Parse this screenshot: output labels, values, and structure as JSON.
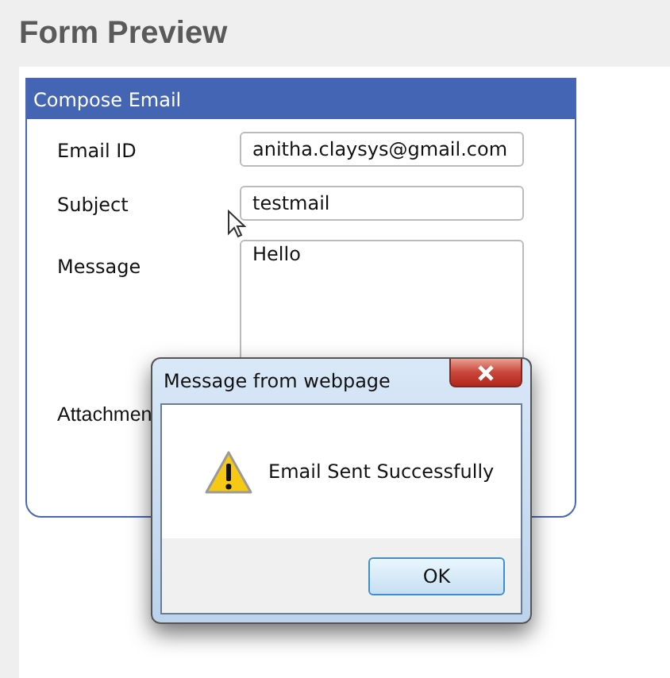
{
  "page": {
    "title": "Form Preview"
  },
  "form": {
    "title": "Compose Email",
    "fields": [
      {
        "kind": "input",
        "label": "Email ID",
        "value": "anitha.claysys@gmail.com"
      },
      {
        "kind": "input",
        "label": "Subject",
        "value": "testmail"
      },
      {
        "kind": "textarea",
        "label": "Message",
        "value": "Hello"
      },
      {
        "kind": "label",
        "label": "Attachmen"
      }
    ]
  },
  "dialog": {
    "title": "Message from webpage",
    "message": "Email Sent Successfully",
    "buttons": [
      "OK"
    ]
  }
}
